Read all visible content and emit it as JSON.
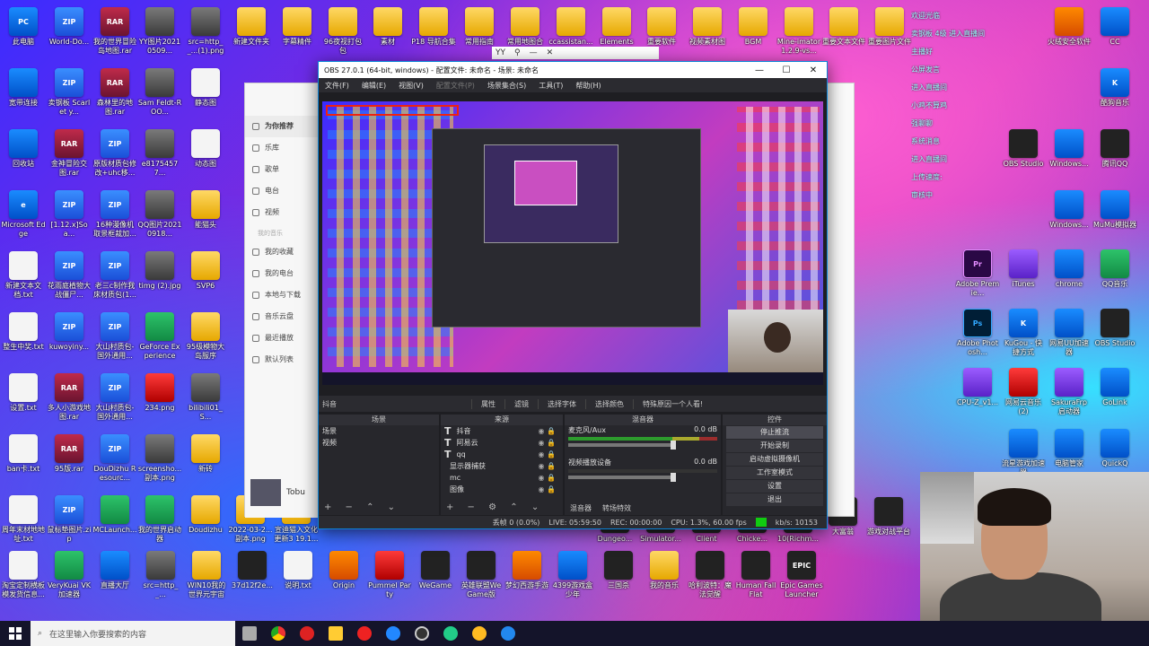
{
  "desktop": {
    "icons": [
      {
        "id": "ic1",
        "label": "此电脑",
        "type": "blue",
        "glyph": "PC"
      },
      {
        "id": "ic2",
        "label": "World-Do...",
        "type": "zip",
        "glyph": "ZIP"
      },
      {
        "id": "ic3",
        "label": "我的世界冒险岛地图.rar",
        "type": "rar",
        "glyph": "RAR"
      },
      {
        "id": "ic4",
        "label": "YY图片20210509...",
        "type": "img",
        "glyph": ""
      },
      {
        "id": "ic5",
        "label": "src=http__...(1).png",
        "type": "img",
        "glyph": ""
      },
      {
        "id": "ic6",
        "label": "新建文件夹",
        "type": "folder",
        "glyph": ""
      },
      {
        "id": "ic7",
        "label": "字幕精件",
        "type": "folder",
        "glyph": ""
      },
      {
        "id": "ic8",
        "label": "96夜视打包包",
        "type": "folder",
        "glyph": ""
      },
      {
        "id": "ic9",
        "label": "素材",
        "type": "folder",
        "glyph": ""
      },
      {
        "id": "ic10",
        "label": "P18 导航合集",
        "type": "folder",
        "glyph": ""
      },
      {
        "id": "ic11",
        "label": "常用指南",
        "type": "folder",
        "glyph": ""
      },
      {
        "id": "ic12",
        "label": "常用地图合",
        "type": "folder",
        "glyph": ""
      },
      {
        "id": "ic13",
        "label": "ccassistan...",
        "type": "folder",
        "glyph": ""
      },
      {
        "id": "ic14",
        "label": "ElementsB...",
        "type": "folder",
        "glyph": ""
      },
      {
        "id": "ic15",
        "label": "重要软件",
        "type": "folder",
        "glyph": ""
      },
      {
        "id": "ic16",
        "label": "视频素材图",
        "type": "folder",
        "glyph": ""
      },
      {
        "id": "ic17",
        "label": "BGM",
        "type": "folder",
        "glyph": ""
      },
      {
        "id": "ic18",
        "label": "Mine-imator 1.2.9-vs...",
        "type": "folder",
        "glyph": ""
      },
      {
        "id": "ic19",
        "label": "重要文本文件",
        "type": "folder",
        "glyph": ""
      },
      {
        "id": "ic20",
        "label": "重要图片文件",
        "type": "folder",
        "glyph": ""
      },
      {
        "id": "ic21",
        "label": "宽带连接",
        "type": "blue",
        "glyph": ""
      },
      {
        "id": "ic22",
        "label": "卖钢板 Scarlet y...",
        "type": "zip",
        "glyph": "ZIP"
      },
      {
        "id": "ic23",
        "label": "森林里的地图.rar",
        "type": "rar",
        "glyph": "RAR"
      },
      {
        "id": "ic24",
        "label": "Sam Feldt-ROO...",
        "type": "img",
        "glyph": ""
      },
      {
        "id": "ic25",
        "label": "静态图",
        "type": "txt",
        "glyph": ""
      },
      {
        "id": "ic26",
        "label": "回收站",
        "type": "blue",
        "glyph": ""
      },
      {
        "id": "ic27",
        "label": "金神冒险交图.rar",
        "type": "rar",
        "glyph": "RAR"
      },
      {
        "id": "ic28",
        "label": "原版材质包修改+uhc移...",
        "type": "zip",
        "glyph": "ZIP"
      },
      {
        "id": "ic29",
        "label": "e81754577...",
        "type": "img",
        "glyph": ""
      },
      {
        "id": "ic30",
        "label": "动态图",
        "type": "txt",
        "glyph": ""
      },
      {
        "id": "ic31",
        "label": "Microsoft Edge",
        "type": "blue",
        "glyph": "e"
      },
      {
        "id": "ic32",
        "label": "[1.12.x]Soa...",
        "type": "zip",
        "glyph": "ZIP"
      },
      {
        "id": "ic33",
        "label": "16种漫像机取景框裁加...",
        "type": "zip",
        "glyph": "ZIP"
      },
      {
        "id": "ic34",
        "label": "QQ图片20210918...",
        "type": "img",
        "glyph": ""
      },
      {
        "id": "ic35",
        "label": "能猫头",
        "type": "folder",
        "glyph": ""
      },
      {
        "id": "ic36",
        "label": "新建文本文档.txt",
        "type": "txt",
        "glyph": ""
      },
      {
        "id": "ic37",
        "label": "花雨庭植物大战僵尸...",
        "type": "zip",
        "glyph": "ZIP"
      },
      {
        "id": "ic38",
        "label": "老三c制作我床材质包(1...",
        "type": "zip",
        "glyph": "ZIP"
      },
      {
        "id": "ic39",
        "label": "timg (2).jpg",
        "type": "img",
        "glyph": ""
      },
      {
        "id": "ic40",
        "label": "SVP6",
        "type": "folder",
        "glyph": ""
      },
      {
        "id": "ic41",
        "label": "整生中奖.txt",
        "type": "txt",
        "glyph": ""
      },
      {
        "id": "ic42",
        "label": "kuwoyiny...",
        "type": "zip",
        "glyph": "ZIP"
      },
      {
        "id": "ic43",
        "label": "大山村质包-国外通用...",
        "type": "zip",
        "glyph": "ZIP"
      },
      {
        "id": "ic44",
        "label": "GeForce Experience",
        "type": "green",
        "glyph": ""
      },
      {
        "id": "ic45",
        "label": "95级模物大岛服序",
        "type": "folder",
        "glyph": ""
      },
      {
        "id": "ic46",
        "label": "设置.txt",
        "type": "txt",
        "glyph": ""
      },
      {
        "id": "ic47",
        "label": "多人小游戏地图.rar",
        "type": "rar",
        "glyph": "RAR"
      },
      {
        "id": "ic48",
        "label": "大山村质包-国外通用...",
        "type": "zip",
        "glyph": "ZIP"
      },
      {
        "id": "ic49",
        "label": "234.png",
        "type": "red",
        "glyph": ""
      },
      {
        "id": "ic50",
        "label": "bilibili01_S...",
        "type": "img",
        "glyph": ""
      },
      {
        "id": "ic51",
        "label": "ban卡.txt",
        "type": "txt",
        "glyph": ""
      },
      {
        "id": "ic52",
        "label": "95版.rar",
        "type": "rar",
        "glyph": "RAR"
      },
      {
        "id": "ic53",
        "label": "DouDizhu Resourc...",
        "type": "zip",
        "glyph": "ZIP"
      },
      {
        "id": "ic54",
        "label": "screensho... 副本.png",
        "type": "img",
        "glyph": ""
      },
      {
        "id": "ic55",
        "label": "新砖",
        "type": "folder",
        "glyph": ""
      },
      {
        "id": "ic56",
        "label": "周年末材地地址.txt",
        "type": "txt",
        "glyph": ""
      },
      {
        "id": "ic57",
        "label": "鼠标垫图片.zip",
        "type": "zip",
        "glyph": "ZIP"
      },
      {
        "id": "ic58",
        "label": "MCLaunch...",
        "type": "green",
        "glyph": ""
      },
      {
        "id": "ic59",
        "label": "我的世界启动器",
        "type": "green",
        "glyph": ""
      },
      {
        "id": "ic60",
        "label": "Doudizhu",
        "type": "folder",
        "glyph": ""
      },
      {
        "id": "ic61",
        "label": "2022-03-2... 副本.png",
        "type": "folder",
        "glyph": ""
      },
      {
        "id": "ic62",
        "label": "宣迪猫入文化更新3 19.1...",
        "type": "folder",
        "glyph": ""
      },
      {
        "id": "ic63",
        "label": "淘宝定制横板模发货信息...",
        "type": "txt",
        "glyph": ""
      },
      {
        "id": "ic64",
        "label": "VeryKuai VK加速器",
        "type": "green",
        "glyph": ""
      },
      {
        "id": "ic65",
        "label": "直播大厅",
        "type": "blue",
        "glyph": ""
      },
      {
        "id": "ic66",
        "label": "src=http__...",
        "type": "img",
        "glyph": ""
      },
      {
        "id": "ic67",
        "label": "WIN10我的世界元宇宙",
        "type": "folder",
        "glyph": ""
      },
      {
        "id": "ic68",
        "label": "37d12f2e...",
        "type": "dark",
        "glyph": ""
      },
      {
        "id": "ic69",
        "label": "说明.txt",
        "type": "txt",
        "glyph": ""
      },
      {
        "id": "ic70",
        "label": "Origin",
        "type": "app",
        "glyph": ""
      },
      {
        "id": "ic71",
        "label": "Pummel Party",
        "type": "red",
        "glyph": ""
      },
      {
        "id": "ic72",
        "label": "WeGame",
        "type": "dark",
        "glyph": ""
      },
      {
        "id": "ic73",
        "label": "英雄联盟WeGame版",
        "type": "dark",
        "glyph": ""
      },
      {
        "id": "ic74",
        "label": "梦幻西游手游",
        "type": "app",
        "glyph": ""
      },
      {
        "id": "ic75",
        "label": "4399游戏盒 少年",
        "type": "blue",
        "glyph": ""
      },
      {
        "id": "ic76",
        "label": "三国杀",
        "type": "dark",
        "glyph": ""
      },
      {
        "id": "ic77",
        "label": "我的音乐",
        "type": "folder",
        "glyph": ""
      },
      {
        "id": "ic78",
        "label": "哈利波特：魔法觉醒",
        "type": "dark",
        "glyph": ""
      },
      {
        "id": "ic79",
        "label": "Human Fall Flat",
        "type": "dark",
        "glyph": ""
      },
      {
        "id": "ic80",
        "label": "Epic Games Launcher",
        "type": "dark",
        "glyph": "EPIC"
      },
      {
        "id": "ic81",
        "label": "Dungeo...",
        "type": "dark",
        "glyph": ""
      },
      {
        "id": "ic82",
        "label": "Simulator...",
        "type": "dark",
        "glyph": ""
      },
      {
        "id": "ic83",
        "label": "Client",
        "type": "dark",
        "glyph": ""
      },
      {
        "id": "ic84",
        "label": "Chicke...",
        "type": "dark",
        "glyph": ""
      },
      {
        "id": "ic85",
        "label": "10(Richm...",
        "type": "dark",
        "glyph": ""
      },
      {
        "id": "ic86",
        "label": "火绒安全软件",
        "type": "app",
        "glyph": ""
      },
      {
        "id": "ic87",
        "label": "CC",
        "type": "blue",
        "glyph": ""
      },
      {
        "id": "ic88",
        "label": "OBS Studio",
        "type": "dark",
        "glyph": ""
      },
      {
        "id": "ic89",
        "label": "Windows...",
        "type": "blue",
        "glyph": ""
      },
      {
        "id": "ic90",
        "label": "腾讯QQ",
        "type": "dark",
        "glyph": ""
      },
      {
        "id": "ic91",
        "label": "Adobe Premie...",
        "type": "pr",
        "glyph": "Pr"
      },
      {
        "id": "ic92",
        "label": "iTunes",
        "type": "purple",
        "glyph": ""
      },
      {
        "id": "ic93",
        "label": "chrome",
        "type": "blue",
        "glyph": ""
      },
      {
        "id": "ic94",
        "label": "QQ音乐",
        "type": "green",
        "glyph": ""
      },
      {
        "id": "ic95",
        "label": "Adobe Photosh...",
        "type": "ps",
        "glyph": "Ps"
      },
      {
        "id": "ic96",
        "label": "KuGou - 快捷方式",
        "type": "blue",
        "glyph": "K"
      },
      {
        "id": "ic97",
        "label": "网易UU加速器",
        "type": "blue",
        "glyph": ""
      },
      {
        "id": "ic98",
        "label": "OBS Studio",
        "type": "dark",
        "glyph": ""
      },
      {
        "id": "ic99",
        "label": "CPU-Z_v1...",
        "type": "purple",
        "glyph": ""
      },
      {
        "id": "ic100",
        "label": "网易云音乐(2)",
        "type": "red",
        "glyph": ""
      },
      {
        "id": "ic101",
        "label": "SakuraFrp 启动器",
        "type": "purple",
        "glyph": ""
      },
      {
        "id": "ic102",
        "label": "GoLink",
        "type": "blue",
        "glyph": ""
      },
      {
        "id": "ic103",
        "label": "流星游戏加速器",
        "type": "blue",
        "glyph": ""
      },
      {
        "id": "ic104",
        "label": "电脑管家",
        "type": "blue",
        "glyph": ""
      },
      {
        "id": "ic105",
        "label": "QuickQ",
        "type": "blue",
        "glyph": ""
      },
      {
        "id": "ic106",
        "label": "酷狗音乐",
        "type": "blue",
        "glyph": "K"
      },
      {
        "id": "ic107",
        "label": "MuMu模拟器",
        "type": "blue",
        "glyph": ""
      },
      {
        "id": "ic108",
        "label": "Windows...",
        "type": "blue",
        "glyph": ""
      },
      {
        "id": "ic109",
        "label": "大富翁",
        "type": "dark",
        "glyph": ""
      },
      {
        "id": "ic110",
        "label": "游戏对战平台",
        "type": "dark",
        "glyph": ""
      }
    ]
  },
  "taskbar": {
    "search_placeholder": "在这里输入你要搜索的内容"
  },
  "obs": {
    "title": "OBS 27.0.1 (64-bit, windows) - 配置文件: 未命名 - 场景: 未命名",
    "menu": [
      "文件(F)",
      "编辑(E)",
      "视图(V)",
      "配置文件(P)",
      "场景集合(S)",
      "工具(T)",
      "帮助(H)"
    ],
    "source_name": "抖音",
    "source_btns": [
      "属性",
      "滤镜",
      "选择字体",
      "选择颜色",
      "特殊原因一个人看!"
    ],
    "docks": {
      "scenes": "场景",
      "sources": "来源",
      "mixer": "混音器",
      "controls": "控件"
    },
    "scenes": [
      "场景",
      "视频"
    ],
    "sources": [
      "抖音",
      "阿易云",
      "qq",
      "显示器捕获",
      "mc",
      "图像"
    ],
    "source_types": [
      "T",
      "T",
      "T",
      "",
      "",
      ""
    ],
    "mixer": [
      {
        "name": "麦克风/Aux",
        "db": "0.0 dB"
      },
      {
        "name": "视频播放设备",
        "db": "0.0 dB"
      }
    ],
    "mixer_tabs": [
      "混音器",
      "转场特效"
    ],
    "controls": [
      "停止推流",
      "开始录制",
      "启动虚拟摄像机",
      "工作室模式",
      "设置",
      "退出"
    ],
    "status": {
      "dropped": "丢帧 0 (0.0%)",
      "live": "LIVE: 05:59:50",
      "rec": "REC: 00:00:00",
      "cpu": "CPU: 1.3%, 60.00 fps",
      "kbs": "kb/s: 10153"
    }
  },
  "music": {
    "nav": [
      "为你推荐",
      "乐库",
      "歌单",
      "电台",
      "视频"
    ],
    "section": "我的音乐",
    "nav2": [
      "我的收藏",
      "我的电台",
      "本地与下载",
      "音乐云盘",
      "最近播放",
      "默认列表"
    ],
    "song": "Tobu"
  },
  "yybar": "YY",
  "chat": {
    "lines": [
      "欢迎光临",
      "卖钢板 4级 进入直播间",
      "主播好",
      "公屏发言",
      "进入直播间",
      "小鸡不算鸡",
      "强聊聊",
      "系统消息",
      "进入直播间",
      "上传速度:",
      "审核中"
    ]
  }
}
